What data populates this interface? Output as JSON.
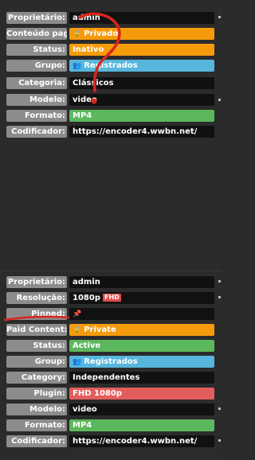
{
  "top_panel": {
    "rows": [
      {
        "label": "Proprietário:",
        "value": "admin",
        "style": "plain"
      },
      {
        "label": "Conteúdo pago:",
        "value": "Privado",
        "style": "orange",
        "icon": "lock-icon"
      },
      {
        "label": "Status:",
        "value": "Inativo",
        "style": "orange"
      },
      {
        "label": "Grupo:",
        "value": "Registrados",
        "style": "blue",
        "icon": "users-icon"
      },
      {
        "label": "Categoria:",
        "value": "Clássicos",
        "style": "plain"
      },
      {
        "label": "Modelo:",
        "value": "video",
        "style": "plain"
      },
      {
        "label": "Formato:",
        "value": "MP4",
        "style": "green"
      },
      {
        "label": "Codificador:",
        "value": "https://encoder4.wwbn.net/",
        "style": "plain"
      }
    ]
  },
  "bottom_panel": {
    "rows": [
      {
        "label": "Proprietário:",
        "value": "admin",
        "style": "plain"
      },
      {
        "label": "Resolução:",
        "value": "1080p",
        "badge": "FHD",
        "style": "plain"
      },
      {
        "label": "Pinned:",
        "value": "",
        "style": "plain",
        "icon": "pin-icon"
      },
      {
        "label": "Paid Content:",
        "value": "Private",
        "style": "orange",
        "icon": "lock-icon"
      },
      {
        "label": "Status:",
        "value": "Active",
        "style": "green"
      },
      {
        "label": "Group:",
        "value": "Registrados",
        "style": "blue",
        "icon": "users-icon"
      },
      {
        "label": "Category:",
        "value": "Independentes",
        "style": "plain"
      },
      {
        "label": "Plugin:",
        "value": "FHD 1080p",
        "style": "red"
      },
      {
        "label": "Modelo:",
        "value": "video",
        "style": "plain"
      },
      {
        "label": "Formato:",
        "value": "MP4",
        "style": "green"
      },
      {
        "label": "Codificador:",
        "value": "https://encoder4.wwbn.net/",
        "style": "plain"
      }
    ]
  },
  "colors": {
    "orange": "#f59b0b",
    "blue": "#57b6dc",
    "green": "#5cb85c",
    "red": "#e35d5d",
    "annotation": "#d9261c"
  }
}
